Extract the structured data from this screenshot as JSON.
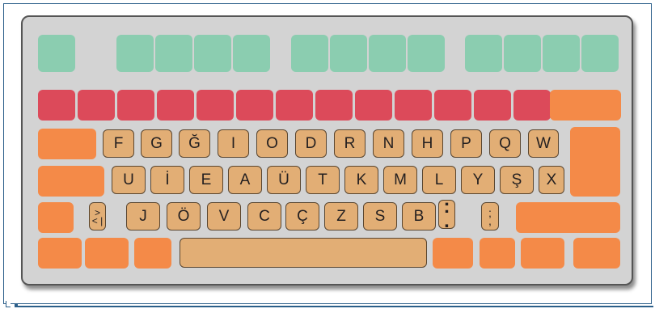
{
  "keyboard": {
    "layout_name": "",
    "colors": {
      "function_row": "#8bcdb0",
      "number_row": "#dc4a5a",
      "modifier": "#f48a48",
      "letter_key": "#e2ae75",
      "body": "#d3d3d3",
      "frame": "#2c5f8a"
    },
    "row1": [
      "F",
      "G",
      "Ğ",
      "I",
      "O",
      "D",
      "R",
      "N",
      "H",
      "P",
      "Q",
      "W"
    ],
    "row2": [
      "U",
      "İ",
      "E",
      "A",
      "Ü",
      "T",
      "K",
      "M",
      "L",
      "Y",
      "Ş",
      "X"
    ],
    "row3": {
      "angle_key_top": ">",
      "angle_key_bottom": "< |",
      "letters": [
        "J",
        "Ö",
        "V",
        "C",
        "Ç",
        "Z",
        "S",
        "B"
      ],
      "colon_key": ":",
      "colon_dot": ".",
      "semicolon_key": ";",
      "semicolon_comma": ","
    }
  }
}
